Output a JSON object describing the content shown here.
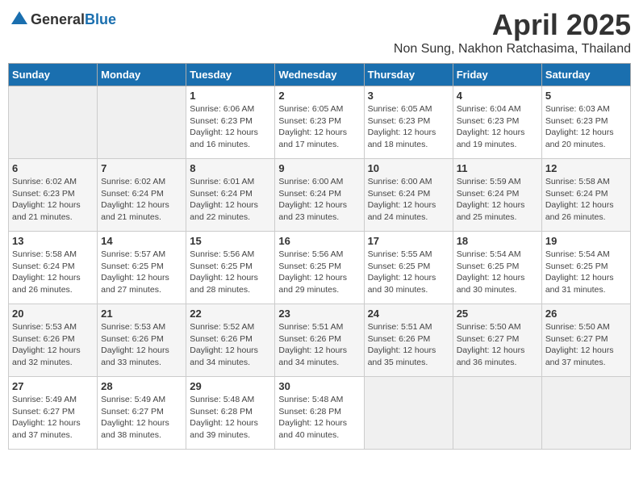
{
  "header": {
    "logo_general": "General",
    "logo_blue": "Blue",
    "month": "April 2025",
    "location": "Non Sung, Nakhon Ratchasima, Thailand"
  },
  "weekdays": [
    "Sunday",
    "Monday",
    "Tuesday",
    "Wednesday",
    "Thursday",
    "Friday",
    "Saturday"
  ],
  "weeks": [
    [
      {
        "day": "",
        "sunrise": "",
        "sunset": "",
        "daylight": "",
        "empty": true
      },
      {
        "day": "",
        "sunrise": "",
        "sunset": "",
        "daylight": "",
        "empty": true
      },
      {
        "day": "1",
        "sunrise": "Sunrise: 6:06 AM",
        "sunset": "Sunset: 6:23 PM",
        "daylight": "Daylight: 12 hours and 16 minutes."
      },
      {
        "day": "2",
        "sunrise": "Sunrise: 6:05 AM",
        "sunset": "Sunset: 6:23 PM",
        "daylight": "Daylight: 12 hours and 17 minutes."
      },
      {
        "day": "3",
        "sunrise": "Sunrise: 6:05 AM",
        "sunset": "Sunset: 6:23 PM",
        "daylight": "Daylight: 12 hours and 18 minutes."
      },
      {
        "day": "4",
        "sunrise": "Sunrise: 6:04 AM",
        "sunset": "Sunset: 6:23 PM",
        "daylight": "Daylight: 12 hours and 19 minutes."
      },
      {
        "day": "5",
        "sunrise": "Sunrise: 6:03 AM",
        "sunset": "Sunset: 6:23 PM",
        "daylight": "Daylight: 12 hours and 20 minutes."
      }
    ],
    [
      {
        "day": "6",
        "sunrise": "Sunrise: 6:02 AM",
        "sunset": "Sunset: 6:23 PM",
        "daylight": "Daylight: 12 hours and 21 minutes."
      },
      {
        "day": "7",
        "sunrise": "Sunrise: 6:02 AM",
        "sunset": "Sunset: 6:24 PM",
        "daylight": "Daylight: 12 hours and 21 minutes."
      },
      {
        "day": "8",
        "sunrise": "Sunrise: 6:01 AM",
        "sunset": "Sunset: 6:24 PM",
        "daylight": "Daylight: 12 hours and 22 minutes."
      },
      {
        "day": "9",
        "sunrise": "Sunrise: 6:00 AM",
        "sunset": "Sunset: 6:24 PM",
        "daylight": "Daylight: 12 hours and 23 minutes."
      },
      {
        "day": "10",
        "sunrise": "Sunrise: 6:00 AM",
        "sunset": "Sunset: 6:24 PM",
        "daylight": "Daylight: 12 hours and 24 minutes."
      },
      {
        "day": "11",
        "sunrise": "Sunrise: 5:59 AM",
        "sunset": "Sunset: 6:24 PM",
        "daylight": "Daylight: 12 hours and 25 minutes."
      },
      {
        "day": "12",
        "sunrise": "Sunrise: 5:58 AM",
        "sunset": "Sunset: 6:24 PM",
        "daylight": "Daylight: 12 hours and 26 minutes."
      }
    ],
    [
      {
        "day": "13",
        "sunrise": "Sunrise: 5:58 AM",
        "sunset": "Sunset: 6:24 PM",
        "daylight": "Daylight: 12 hours and 26 minutes."
      },
      {
        "day": "14",
        "sunrise": "Sunrise: 5:57 AM",
        "sunset": "Sunset: 6:25 PM",
        "daylight": "Daylight: 12 hours and 27 minutes."
      },
      {
        "day": "15",
        "sunrise": "Sunrise: 5:56 AM",
        "sunset": "Sunset: 6:25 PM",
        "daylight": "Daylight: 12 hours and 28 minutes."
      },
      {
        "day": "16",
        "sunrise": "Sunrise: 5:56 AM",
        "sunset": "Sunset: 6:25 PM",
        "daylight": "Daylight: 12 hours and 29 minutes."
      },
      {
        "day": "17",
        "sunrise": "Sunrise: 5:55 AM",
        "sunset": "Sunset: 6:25 PM",
        "daylight": "Daylight: 12 hours and 30 minutes."
      },
      {
        "day": "18",
        "sunrise": "Sunrise: 5:54 AM",
        "sunset": "Sunset: 6:25 PM",
        "daylight": "Daylight: 12 hours and 30 minutes."
      },
      {
        "day": "19",
        "sunrise": "Sunrise: 5:54 AM",
        "sunset": "Sunset: 6:25 PM",
        "daylight": "Daylight: 12 hours and 31 minutes."
      }
    ],
    [
      {
        "day": "20",
        "sunrise": "Sunrise: 5:53 AM",
        "sunset": "Sunset: 6:26 PM",
        "daylight": "Daylight: 12 hours and 32 minutes."
      },
      {
        "day": "21",
        "sunrise": "Sunrise: 5:53 AM",
        "sunset": "Sunset: 6:26 PM",
        "daylight": "Daylight: 12 hours and 33 minutes."
      },
      {
        "day": "22",
        "sunrise": "Sunrise: 5:52 AM",
        "sunset": "Sunset: 6:26 PM",
        "daylight": "Daylight: 12 hours and 34 minutes."
      },
      {
        "day": "23",
        "sunrise": "Sunrise: 5:51 AM",
        "sunset": "Sunset: 6:26 PM",
        "daylight": "Daylight: 12 hours and 34 minutes."
      },
      {
        "day": "24",
        "sunrise": "Sunrise: 5:51 AM",
        "sunset": "Sunset: 6:26 PM",
        "daylight": "Daylight: 12 hours and 35 minutes."
      },
      {
        "day": "25",
        "sunrise": "Sunrise: 5:50 AM",
        "sunset": "Sunset: 6:27 PM",
        "daylight": "Daylight: 12 hours and 36 minutes."
      },
      {
        "day": "26",
        "sunrise": "Sunrise: 5:50 AM",
        "sunset": "Sunset: 6:27 PM",
        "daylight": "Daylight: 12 hours and 37 minutes."
      }
    ],
    [
      {
        "day": "27",
        "sunrise": "Sunrise: 5:49 AM",
        "sunset": "Sunset: 6:27 PM",
        "daylight": "Daylight: 12 hours and 37 minutes."
      },
      {
        "day": "28",
        "sunrise": "Sunrise: 5:49 AM",
        "sunset": "Sunset: 6:27 PM",
        "daylight": "Daylight: 12 hours and 38 minutes."
      },
      {
        "day": "29",
        "sunrise": "Sunrise: 5:48 AM",
        "sunset": "Sunset: 6:28 PM",
        "daylight": "Daylight: 12 hours and 39 minutes."
      },
      {
        "day": "30",
        "sunrise": "Sunrise: 5:48 AM",
        "sunset": "Sunset: 6:28 PM",
        "daylight": "Daylight: 12 hours and 40 minutes."
      },
      {
        "day": "",
        "sunrise": "",
        "sunset": "",
        "daylight": "",
        "empty": true
      },
      {
        "day": "",
        "sunrise": "",
        "sunset": "",
        "daylight": "",
        "empty": true
      },
      {
        "day": "",
        "sunrise": "",
        "sunset": "",
        "daylight": "",
        "empty": true
      }
    ]
  ]
}
